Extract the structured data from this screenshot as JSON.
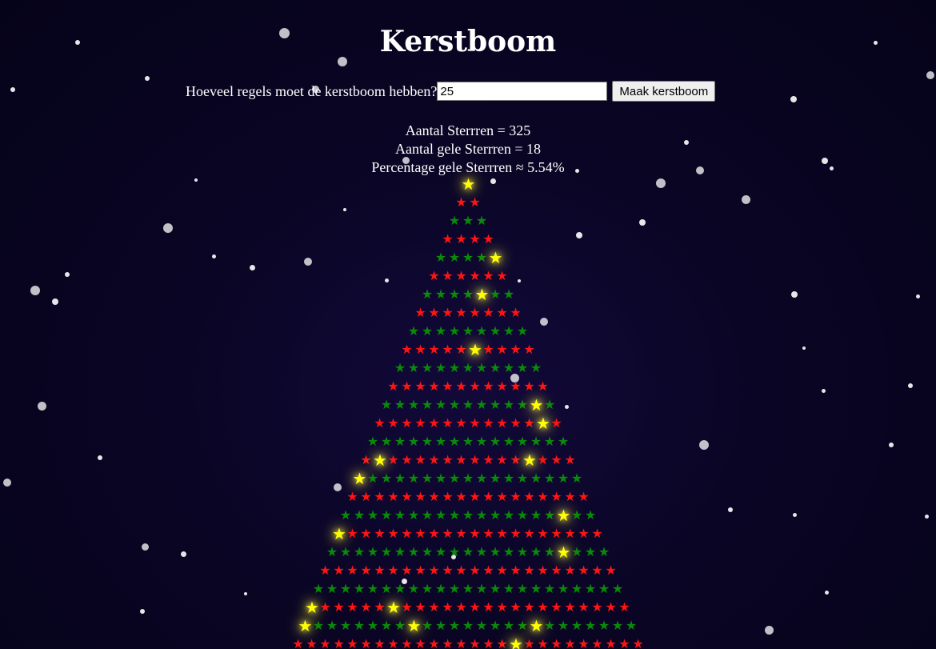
{
  "page": {
    "title": "Kerstboom",
    "form": {
      "label": "Hoeveel regels moet de kerstboom hebben?",
      "input_value": "25",
      "button_label": "Maak kerstboom"
    },
    "stats": {
      "total": "Aantal Sterrren = 325",
      "yellow": "Aantal gele Sterrren = 18",
      "percentage": "Percentage gele Sterrren ≈ 5.54%"
    }
  },
  "tree": {
    "rows": 25,
    "star_glyph": "★",
    "row_colors": [
      "red",
      "green"
    ],
    "yellow_positions": [
      [
        0,
        0
      ],
      [
        4,
        4
      ],
      [
        6,
        4
      ],
      [
        9,
        5
      ],
      [
        12,
        11
      ],
      [
        13,
        12
      ],
      [
        15,
        1
      ],
      [
        15,
        12
      ],
      [
        16,
        0
      ],
      [
        18,
        16
      ],
      [
        19,
        0
      ],
      [
        20,
        17
      ],
      [
        23,
        0
      ],
      [
        23,
        6
      ],
      [
        24,
        0
      ],
      [
        24,
        8
      ],
      [
        24,
        17
      ],
      [
        25,
        16
      ]
    ],
    "colors": {
      "red": "#ff1414",
      "green": "#0a8a0a",
      "yellow": "#ffff00"
    }
  },
  "background": {
    "color": "#0a0524",
    "snow_color": "#ffffff"
  }
}
